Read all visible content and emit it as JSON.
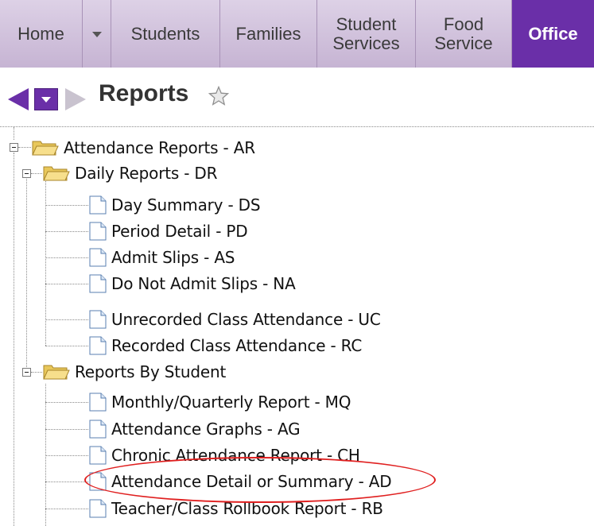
{
  "nav": {
    "tabs": [
      {
        "label": "Home"
      },
      {
        "label": "Students"
      },
      {
        "label": "Families"
      },
      {
        "label": "Student",
        "label2": "Services"
      },
      {
        "label": "Food",
        "label2": "Service"
      },
      {
        "label": "Office",
        "active": true
      }
    ],
    "dropdown_icon": "caret-down-icon"
  },
  "header": {
    "title": "Reports",
    "back_icon": "back-arrow-icon",
    "history_icon": "history-dropdown-icon",
    "forward_icon": "forward-arrow-icon",
    "favorite_icon": "star-icon"
  },
  "tree": {
    "root": {
      "label": "Attendance Reports - AR"
    },
    "daily": {
      "label": "Daily Reports - DR",
      "items": [
        "Day Summary - DS",
        "Period Detail - PD",
        "Admit Slips - AS",
        "Do Not Admit Slips - NA",
        "Unrecorded Class Attendance - UC",
        "Recorded Class Attendance - RC"
      ]
    },
    "by_student": {
      "label": "Reports By Student",
      "items": [
        "Monthly/Quarterly Report - MQ",
        "Attendance Graphs - AG",
        "Chronic Attendance Report - CH",
        "Attendance Detail or Summary - AD",
        "Teacher/Class Rollbook Report - RB"
      ]
    }
  },
  "colors": {
    "accent": "#6a2fa8",
    "nav_bg": "#c9b8d6",
    "highlight": "#e02020"
  }
}
